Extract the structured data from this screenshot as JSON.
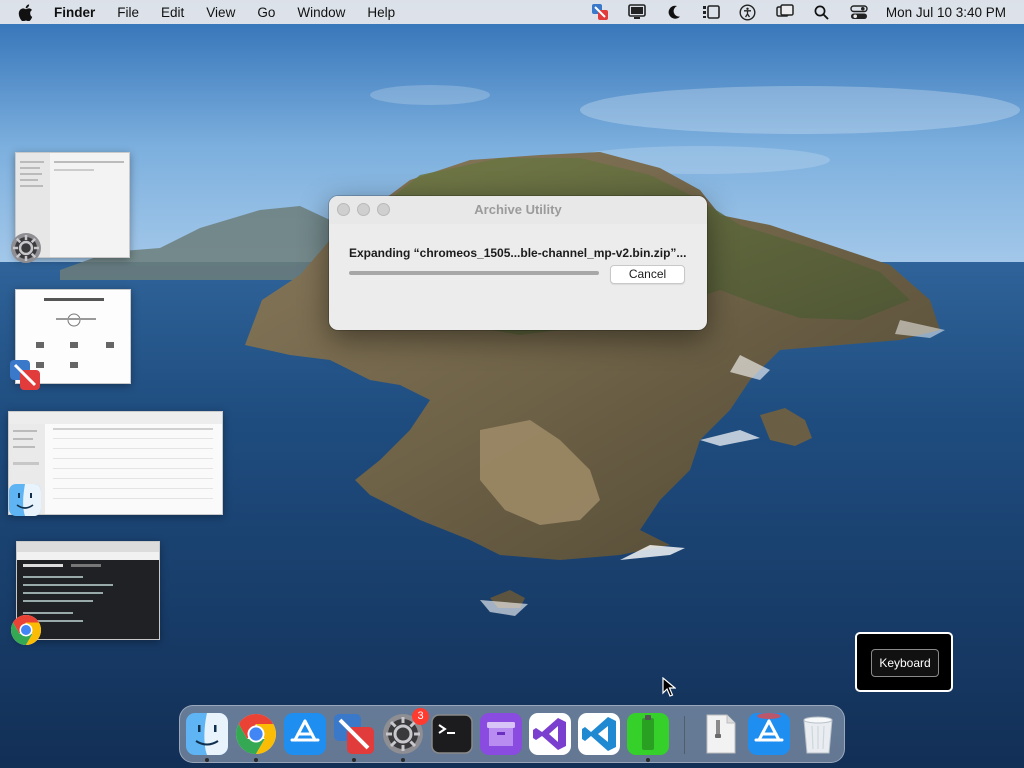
{
  "menubar": {
    "apple_icon": "apple-icon",
    "app_name": "Finder",
    "menus": [
      "File",
      "Edit",
      "View",
      "Go",
      "Window",
      "Help"
    ],
    "status_icons": [
      "vmware-fusion-icon",
      "display-icon",
      "focus-moon-icon",
      "stage-manager-icon",
      "accessibility-icon",
      "screen-mirroring-icon",
      "spotlight-search-icon",
      "control-center-icon"
    ],
    "clock": "Mon Jul 10  3:40 PM"
  },
  "archive_window": {
    "title": "Archive Utility",
    "message": "Expanding “chromeos_1505...ble-channel_mp-v2.bin.zip”...",
    "progress": 1.0,
    "cancel_label": "Cancel"
  },
  "thumbnails": [
    {
      "app": "System Settings",
      "icon": "system-settings-icon"
    },
    {
      "app": "VMware Fusion",
      "icon": "vmware-fusion-icon"
    },
    {
      "app": "Finder",
      "icon": "finder-icon"
    },
    {
      "app": "Google Chrome",
      "icon": "chrome-icon"
    }
  ],
  "keyboard_overlay": {
    "label": "Keyboard"
  },
  "dock": {
    "items": [
      {
        "name": "Finder",
        "icon": "finder-icon",
        "running": true
      },
      {
        "name": "Google Chrome",
        "icon": "chrome-icon",
        "running": true
      },
      {
        "name": "App Store",
        "icon": "app-store-icon",
        "running": false
      },
      {
        "name": "VMware Fusion",
        "icon": "vmware-fusion-icon",
        "running": true
      },
      {
        "name": "System Settings",
        "icon": "system-settings-icon",
        "running": true,
        "badge": "3"
      },
      {
        "name": "Terminal",
        "icon": "terminal-icon",
        "running": false
      },
      {
        "name": "Archive Utility",
        "icon": "archive-utility-icon",
        "running": false
      },
      {
        "name": "Visual Studio",
        "icon": "visual-studio-icon",
        "running": false
      },
      {
        "name": "Visual Studio Code",
        "icon": "vscode-icon",
        "running": false
      },
      {
        "name": "Android File Transfer",
        "icon": "android-file-transfer-icon",
        "running": true
      },
      {
        "name": "Document",
        "icon": "document-file-icon",
        "running": false
      },
      {
        "name": "App Store Installer",
        "icon": "app-store-icon",
        "running": false
      },
      {
        "name": "Trash",
        "icon": "trash-icon",
        "running": false
      }
    ]
  },
  "colors": {
    "menubar_bg": "#ececee",
    "badge": "#ff3b30",
    "ocean": "#1f4b7e",
    "sky": "#7fb1df"
  }
}
